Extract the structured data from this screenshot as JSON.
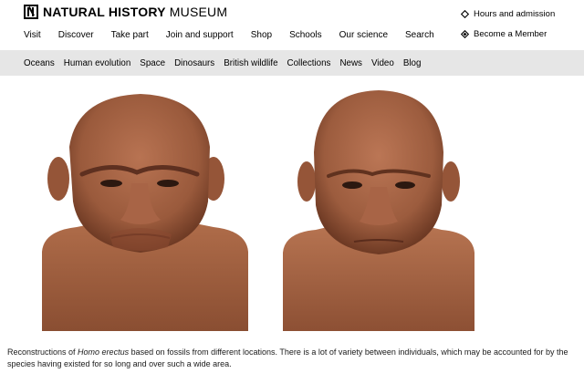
{
  "logo": {
    "bold": "NATURAL HISTORY",
    "regular": " MUSEUM",
    "mark": "N"
  },
  "utility": {
    "hours": "Hours and admission",
    "member": "Become a Member"
  },
  "mainnav": [
    {
      "label": "Visit",
      "active": false
    },
    {
      "label": "Discover",
      "active": true
    },
    {
      "label": "Take part",
      "active": false
    },
    {
      "label": "Join and support",
      "active": false
    },
    {
      "label": "Shop",
      "active": false
    },
    {
      "label": "Schools",
      "active": false
    },
    {
      "label": "Our science",
      "active": false
    },
    {
      "label": "Search",
      "active": false
    }
  ],
  "subnav": [
    "Oceans",
    "Human evolution",
    "Space",
    "Dinosaurs",
    "British wildlife",
    "Collections",
    "News",
    "Video",
    "Blog"
  ],
  "caption": {
    "before": "Reconstructions of ",
    "species": "Homo erectus",
    "after": " based on fossils from different locations. There is a lot of variety between individuals, which may be accounted for by the species having existed for so long and over such a wide area."
  },
  "colors": {
    "subnav_bg": "#e6e6e6",
    "skin": "#9a5a3c",
    "skin_light": "#b87352",
    "skin_dark": "#6e3a24"
  }
}
